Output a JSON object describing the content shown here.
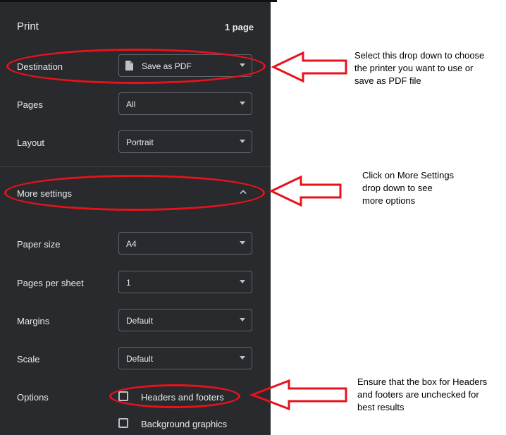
{
  "print": {
    "title": "Print",
    "page_count": "1 page",
    "destination": {
      "label": "Destination",
      "value": "Save as PDF"
    },
    "pages": {
      "label": "Pages",
      "value": "All"
    },
    "layout": {
      "label": "Layout",
      "value": "Portrait"
    },
    "more_settings": {
      "label": "More settings"
    },
    "paper_size": {
      "label": "Paper size",
      "value": "A4"
    },
    "pages_per_sheet": {
      "label": "Pages per sheet",
      "value": "1"
    },
    "margins": {
      "label": "Margins",
      "value": "Default"
    },
    "scale": {
      "label": "Scale",
      "value": "Default"
    },
    "options": {
      "label": "Options",
      "headers_footers": {
        "label": "Headers and footers",
        "checked": false
      },
      "background_graphics": {
        "label": "Background graphics",
        "checked": false
      }
    }
  },
  "annotations": {
    "destination_note": [
      "Select this drop down to choose",
      "the printer you want to use or",
      "save as PDF file"
    ],
    "more_settings_note": [
      "Click on More Settings",
      "drop down to see",
      "more options"
    ],
    "headers_note": [
      "Ensure that the box for Headers",
      "and footers are unchecked for",
      "best results"
    ],
    "highlight_color": "#e8121c"
  },
  "colors": {
    "panel": "#292a2d",
    "text": "#e8eaed",
    "border": "#5f6368"
  }
}
